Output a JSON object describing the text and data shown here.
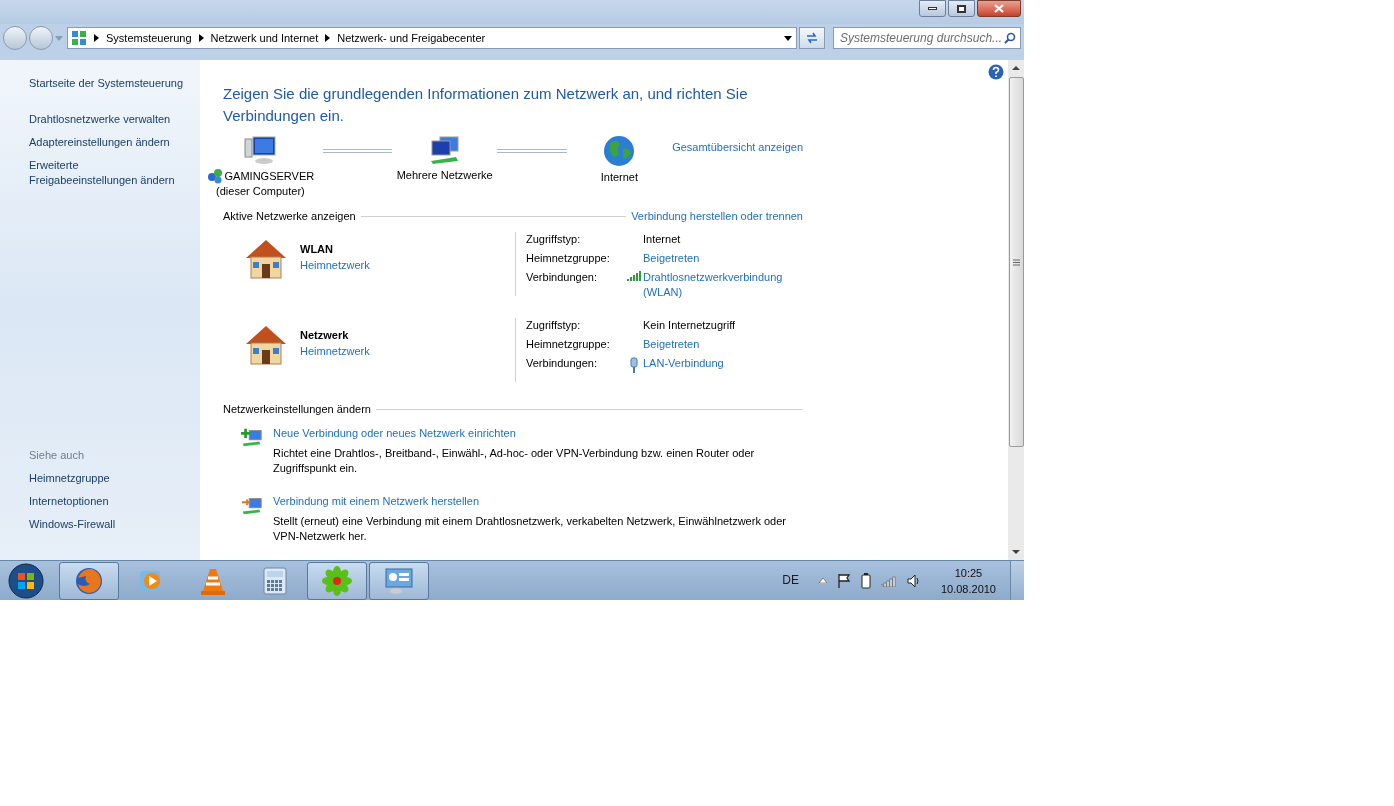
{
  "breadcrumb": [
    "Systemsteuerung",
    "Netzwerk und Internet",
    "Netzwerk- und Freigabecenter"
  ],
  "search": {
    "placeholder": "Systemsteuerung durchsuch..."
  },
  "sidebar": {
    "links": [
      "Startseite der Systemsteuerung",
      "Drahtlosnetzwerke verwalten",
      "Adaptereinstellungen ändern",
      "Erweiterte Freigabeeinstellungen ändern"
    ],
    "see_also_heading": "Siehe auch",
    "see_also": [
      "Heimnetzgruppe",
      "Internetoptionen",
      "Windows-Firewall"
    ]
  },
  "heading": "Zeigen Sie die grundlegenden Informationen zum Netzwerk an, und richten Sie Verbindungen ein.",
  "map": {
    "nodes": [
      {
        "kind": "computer",
        "label": "GAMINGSERVER",
        "sublabel": "(dieser Computer)"
      },
      {
        "kind": "networks",
        "label": "Mehrere Netzwerke"
      },
      {
        "kind": "globe",
        "label": "Internet"
      }
    ],
    "link": "Gesamtübersicht anzeigen"
  },
  "active": {
    "title": "Aktive Netzwerke anzeigen",
    "link": "Verbindung herstellen oder trennen",
    "networks": [
      {
        "name": "WLAN",
        "type": "Heimnetzwerk",
        "rows": [
          {
            "kind": "text",
            "label": "Zugriffstyp:",
            "value": "Internet"
          },
          {
            "kind": "link",
            "label": "Heimnetzgruppe:",
            "value": "Beigetreten"
          },
          {
            "kind": "wifi",
            "label": "Verbindungen:",
            "value": "Drahtlosnetzwerkverbindung (WLAN)"
          }
        ]
      },
      {
        "name": "Netzwerk",
        "type": "Heimnetzwerk",
        "rows": [
          {
            "kind": "text",
            "label": "Zugriffstyp:",
            "value": "Kein Internetzugriff"
          },
          {
            "kind": "link",
            "label": "Heimnetzgruppe:",
            "value": "Beigetreten"
          },
          {
            "kind": "lan",
            "label": "Verbindungen:",
            "value": "LAN-Verbindung"
          }
        ]
      }
    ]
  },
  "settings": {
    "title": "Netzwerkeinstellungen ändern",
    "tasks": [
      {
        "kind": "new",
        "title": "Neue Verbindung oder neues Netzwerk einrichten",
        "description": "Richtet eine Drahtlos-, Breitband-, Einwähl-, Ad-hoc- oder VPN-Verbindung bzw. einen Router oder Zugriffspunkt ein."
      },
      {
        "kind": "connect",
        "title": "Verbindung mit einem Netzwerk herstellen",
        "description": "Stellt (erneut) eine Verbindung mit einem Drahtlosnetzwerk, verkabelten Netzwerk, Einwählnetzwerk oder VPN-Netzwerk her."
      }
    ]
  },
  "taskbar": {
    "apps": [
      {
        "kind": "firefox",
        "active": true
      },
      {
        "kind": "media",
        "active": false
      },
      {
        "kind": "vlc",
        "active": false
      },
      {
        "kind": "calculator",
        "active": false
      },
      {
        "kind": "flower",
        "active": true
      },
      {
        "kind": "panel",
        "active": true
      }
    ],
    "language": "DE",
    "time": "10:25",
    "date": "10.08.2010"
  }
}
